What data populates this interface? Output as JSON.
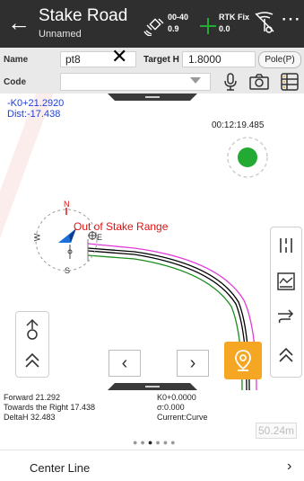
{
  "header": {
    "title": "Stake Road",
    "subtitle": "Unnamed",
    "sat_top": "00-40",
    "sat_bottom": "0.9",
    "rtk_top": "RTK Fix",
    "rtk_bottom": "0.0",
    "back_glyph": "←",
    "more_glyph": "⋯"
  },
  "form": {
    "name_label": "Name",
    "name_value": "pt8",
    "target_label": "Target H",
    "target_value": "1.8000",
    "pole_button": "Pole(P)",
    "code_label": "Code",
    "code_value": ""
  },
  "map": {
    "mileage_line1": "-K0+21.2920",
    "mileage_line2": "Dist:-17.438",
    "timer": "00:12:19.485",
    "range_warning": "Out of Stake Range",
    "compass_n": "N",
    "compass_s": "S",
    "compass_w": "W",
    "compass_e": "E"
  },
  "info": {
    "forward": "Forward 21.292",
    "towards": "Towards the Right 17.438",
    "deltah": "DeltaH 32.483",
    "station": "K0+0.0000",
    "sigma": "σ:0.000",
    "current": "Current:Curve",
    "scale": "50.24m"
  },
  "bottom": {
    "label": "Center Line",
    "chevron": "›"
  },
  "colors": {
    "header_bg": "#2f2f2f",
    "accent_orange": "#f5a623",
    "fix_green": "#22aa33",
    "mileage_blue": "#1f3fd9",
    "warning_red": "#e01010",
    "road_magenta": "#e03ad8",
    "road_green": "#1c8c1c"
  }
}
